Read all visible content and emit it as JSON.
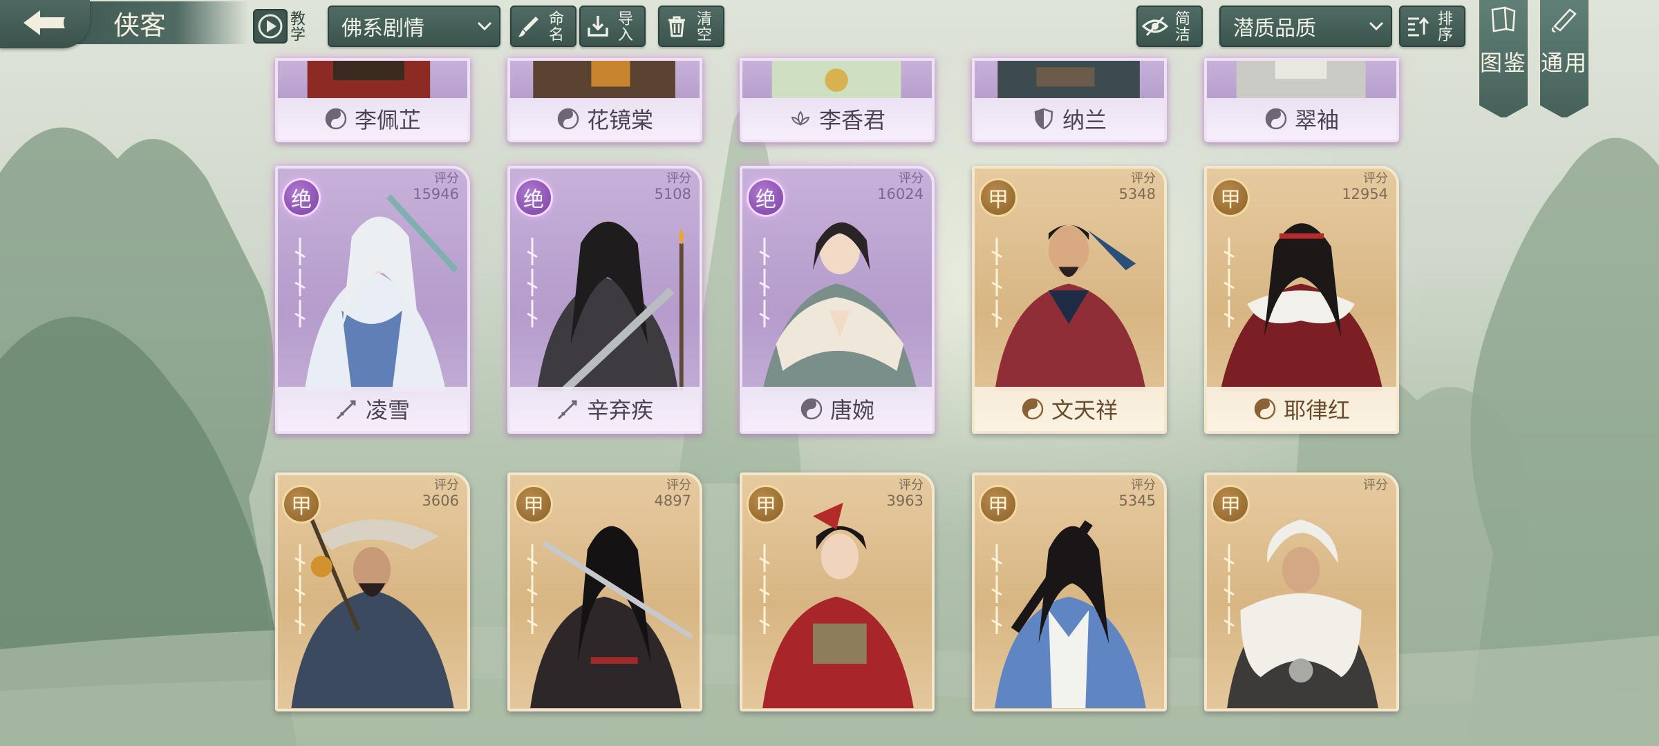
{
  "header": {
    "title": "侠客",
    "tutorial_label": "教学",
    "faction_dropdown": "佛系剧情",
    "rename_label": "命名",
    "import_label": "导入",
    "clear_label": "清空",
    "brief_label": "简洁",
    "quality_dropdown": "潜质品质",
    "sort_label": "排序"
  },
  "side_banners": {
    "codex_label": "图鉴",
    "general_label": "通用"
  },
  "score_label": "评分",
  "cards_row1": [
    {
      "name": "李佩芷",
      "school": "taiji",
      "tier": "jue"
    },
    {
      "name": "花镜棠",
      "school": "taiji",
      "tier": "jue"
    },
    {
      "name": "李香君",
      "school": "lotus",
      "tier": "jue"
    },
    {
      "name": "纳兰",
      "school": "shield",
      "tier": "jue"
    },
    {
      "name": "翠袖",
      "school": "taiji",
      "tier": "jue"
    }
  ],
  "cards_row2": [
    {
      "name": "凌雪",
      "rank": "绝",
      "score": "15946",
      "school": "sword",
      "tier": "jue"
    },
    {
      "name": "辛弃疾",
      "rank": "绝",
      "score": "5108",
      "school": "sword",
      "tier": "jue"
    },
    {
      "name": "唐婉",
      "rank": "绝",
      "score": "16024",
      "school": "taiji",
      "tier": "jue"
    },
    {
      "name": "文天祥",
      "rank": "甲",
      "score": "5348",
      "school": "taiji",
      "tier": "jia"
    },
    {
      "name": "耶律红",
      "rank": "甲",
      "score": "12954",
      "school": "taiji",
      "tier": "jia"
    }
  ],
  "cards_row3": [
    {
      "rank": "甲",
      "score": "3606",
      "tier": "jia"
    },
    {
      "rank": "甲",
      "score": "4897",
      "tier": "jia"
    },
    {
      "rank": "甲",
      "score": "3963",
      "tier": "jia"
    },
    {
      "rank": "甲",
      "score": "5345",
      "tier": "jia"
    },
    {
      "rank": "甲",
      "score": "",
      "tier": "jia"
    }
  ]
}
